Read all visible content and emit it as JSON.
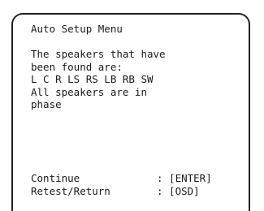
{
  "menu": {
    "title": "Auto Setup Menu",
    "message_lines": [
      "The speakers that have",
      "been found are:",
      "L C R LS RS LB RB SW",
      "All speakers are in",
      "phase"
    ]
  },
  "actions": [
    {
      "label": "Continue",
      "key": ": [ENTER]"
    },
    {
      "label": "Retest/Return",
      "key": ": [OSD]"
    }
  ]
}
